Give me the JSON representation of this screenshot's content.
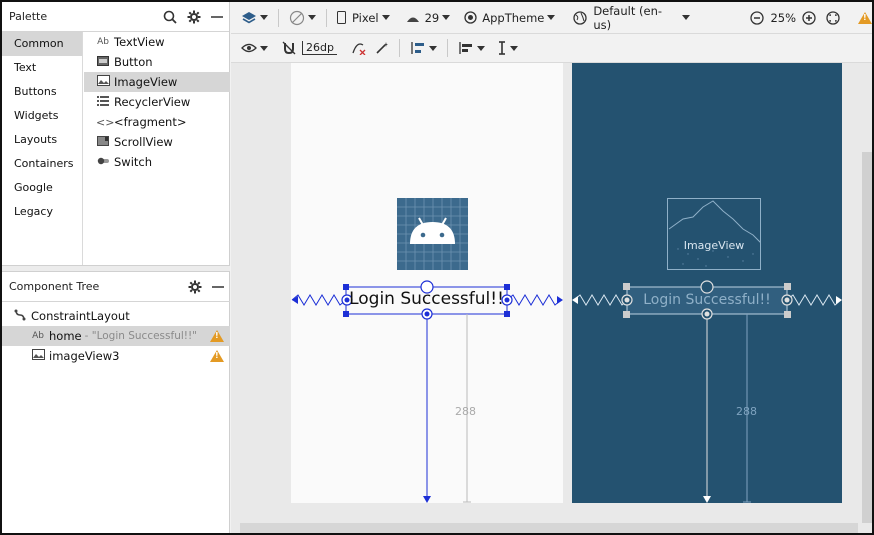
{
  "palette": {
    "title": "Palette",
    "categories": [
      "Common",
      "Text",
      "Buttons",
      "Widgets",
      "Layouts",
      "Containers",
      "Google",
      "Legacy"
    ],
    "selected_category": "Common",
    "widgets": [
      {
        "label": "TextView",
        "icon": "text-icon"
      },
      {
        "label": "Button",
        "icon": "button-icon"
      },
      {
        "label": "ImageView",
        "icon": "image-icon"
      },
      {
        "label": "RecyclerView",
        "icon": "list-icon"
      },
      {
        "label": "<fragment>",
        "icon": "code-icon"
      },
      {
        "label": "ScrollView",
        "icon": "scroll-icon"
      },
      {
        "label": "Switch",
        "icon": "switch-icon"
      }
    ],
    "selected_widget": "ImageView"
  },
  "component_tree": {
    "title": "Component Tree",
    "root": "ConstraintLayout",
    "items": [
      {
        "id": "home",
        "hint": "- \"Login Successful!!\"",
        "icon": "text-icon",
        "warning": true,
        "selected": true
      },
      {
        "id": "imageView3",
        "hint": "",
        "icon": "image-icon",
        "warning": true,
        "selected": false
      }
    ]
  },
  "toolbar": {
    "device": "Pixel",
    "api": "29",
    "theme": "AppTheme",
    "locale": "Default (en-us)",
    "zoom": "25%",
    "margin": "26dp"
  },
  "design": {
    "text": "Login Successful!!",
    "image_label": "ImageView",
    "dimension": "288"
  },
  "colors": {
    "blueprint": "#245270",
    "selection": "#1c2fd6",
    "warning": "#e39a24",
    "android": "#3c6a8d"
  }
}
